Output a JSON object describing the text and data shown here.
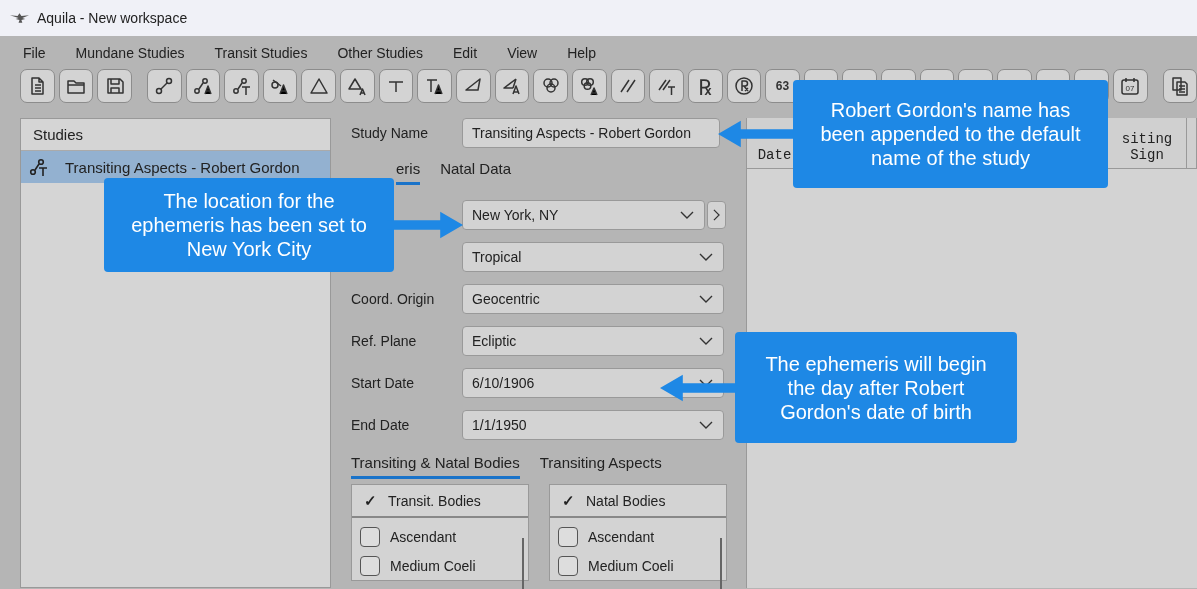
{
  "window": {
    "title": "Aquila - New workspace"
  },
  "menu": [
    "File",
    "Mundane Studies",
    "Transit Studies",
    "Other Studies",
    "Edit",
    "View",
    "Help"
  ],
  "toolbar": [
    {
      "kind": "icon"
    },
    {
      "kind": "icon"
    },
    {
      "kind": "icon"
    },
    {
      "kind": "icon"
    },
    {
      "kind": "icon"
    },
    {
      "kind": "icon"
    },
    {
      "kind": "icon"
    },
    {
      "kind": "icon"
    },
    {
      "kind": "icon"
    },
    {
      "kind": "icon"
    },
    {
      "kind": "icon"
    },
    {
      "kind": "icon"
    },
    {
      "kind": "icon"
    },
    {
      "kind": "icon"
    },
    {
      "kind": "icon"
    },
    {
      "kind": "icon"
    },
    {
      "kind": "icon"
    },
    {
      "kind": "text",
      "label": "℞"
    },
    {
      "kind": "icon"
    },
    {
      "kind": "text",
      "label": "63"
    },
    {
      "kind": "icon"
    },
    {
      "kind": "icon"
    },
    {
      "kind": "icon"
    },
    {
      "kind": "icon"
    },
    {
      "kind": "icon"
    },
    {
      "kind": "icon"
    },
    {
      "kind": "icon"
    },
    {
      "kind": "icon"
    },
    {
      "kind": "icon",
      "label": "07"
    },
    {
      "kind": "icon"
    }
  ],
  "studies": {
    "title": "Studies",
    "items": [
      {
        "label": "Transiting Aspects - Robert Gordon",
        "selected": true
      }
    ]
  },
  "study_name": {
    "label": "Study Name",
    "value": "Transiting Aspects - Robert Gordon"
  },
  "tabs": [
    {
      "label": "eris",
      "selected": true
    },
    {
      "label": "Natal Data",
      "selected": false
    }
  ],
  "fields": [
    {
      "value": "New York, NY",
      "kind": "location"
    },
    {
      "value": "Tropical",
      "kind": "dropdown"
    },
    {
      "label": "Coord. Origin",
      "value": "Geocentric",
      "kind": "dropdown"
    },
    {
      "label": "Ref. Plane",
      "value": "Ecliptic",
      "kind": "dropdown"
    },
    {
      "label": "Start Date",
      "value": "6/10/1906",
      "kind": "date"
    },
    {
      "label": "End Date",
      "value": "1/1/1950",
      "kind": "dropdown"
    }
  ],
  "body_tabs": [
    {
      "label": "Transiting & Natal Bodies",
      "selected": true
    },
    {
      "label": "Transiting Aspects",
      "selected": false
    }
  ],
  "lists": [
    {
      "header": "Transit. Bodies",
      "check_mark": "✓",
      "checked": true,
      "items": [
        {
          "label": "Ascendant",
          "checked": false
        },
        {
          "label": "Medium Coeli",
          "checked": false
        }
      ]
    },
    {
      "header": "Natal Bodies",
      "check_mark": "✓",
      "checked": true,
      "items": [
        {
          "label": "Ascendant",
          "checked": false
        },
        {
          "label": "Medium Coeli",
          "checked": false
        }
      ]
    }
  ],
  "table": {
    "columns": [
      "Date",
      "siting Sign"
    ]
  },
  "callouts": [
    {
      "text": "Robert Gordon's name has been appended to the default name of the study"
    },
    {
      "text": "The location for the ephemeris has been set to New York City"
    },
    {
      "text": "The ephemeris will begin the day after Robert Gordon's date of birth"
    }
  ]
}
